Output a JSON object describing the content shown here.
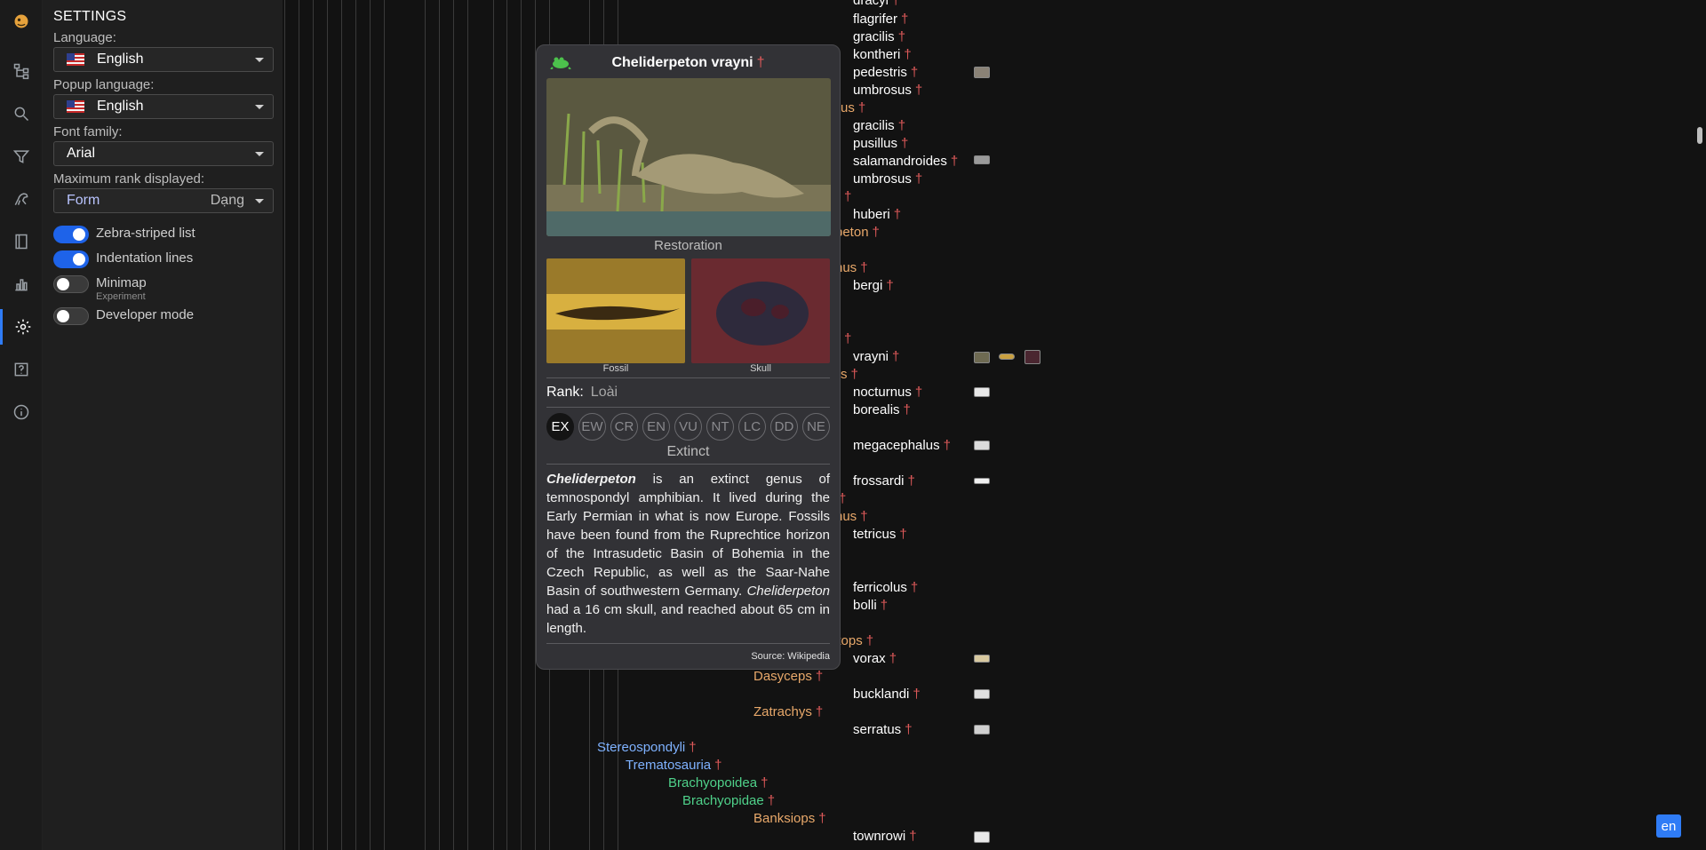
{
  "nav": {
    "items": [
      {
        "name": "logo-icon"
      },
      {
        "name": "tree-icon"
      },
      {
        "name": "search-icon"
      },
      {
        "name": "filter-icon"
      },
      {
        "name": "dinosaur-icon"
      },
      {
        "name": "book-icon"
      },
      {
        "name": "stats-icon"
      },
      {
        "name": "settings-icon"
      },
      {
        "name": "help-icon"
      },
      {
        "name": "info-icon"
      }
    ]
  },
  "settings": {
    "title": "SETTINGS",
    "language_label": "Language:",
    "language_value": "English",
    "popup_language_label": "Popup language:",
    "popup_language_value": "English",
    "font_label": "Font family:",
    "font_value": "Arial",
    "rank_label": "Maximum rank displayed:",
    "rank_value": "Form",
    "rank_value_local": "Dạng",
    "toggles": [
      {
        "label": "Zebra-striped list",
        "on": true
      },
      {
        "label": "Indentation lines",
        "on": true
      },
      {
        "label": "Minimap",
        "sub": "Experiment",
        "on": false
      },
      {
        "label": "Developer mode",
        "on": false
      }
    ]
  },
  "tree": {
    "dagger": "†",
    "species": [
      {
        "name": "dracyi"
      },
      {
        "name": "flagrifer"
      },
      {
        "name": "gracilis"
      },
      {
        "name": "kontheri"
      },
      {
        "name": "pedestris"
      },
      {
        "name": "umbrosus"
      },
      {
        "name": "gracilis"
      },
      {
        "name": "pusillus"
      },
      {
        "name": "salamandroides"
      },
      {
        "name": "umbrosus"
      },
      {
        "name": "huberi"
      },
      {
        "name": "bergi"
      },
      {
        "name": "vrayni"
      },
      {
        "name": "nocturnus"
      },
      {
        "name": "borealis"
      },
      {
        "name": "megacephalus"
      },
      {
        "name": "frossardi"
      },
      {
        "name": "tetricus"
      },
      {
        "name": "ferricolus"
      },
      {
        "name": "bolli"
      },
      {
        "name": "vorax"
      },
      {
        "name": "bucklandi"
      },
      {
        "name": "serratus"
      },
      {
        "name": "townrowi"
      }
    ],
    "genus_fragments": [
      "us",
      "peton",
      "nus",
      "s",
      "nus",
      "atops"
    ],
    "genera": [
      "Dasyceps",
      "Zatrachys",
      "Banksiops"
    ],
    "families": [
      {
        "name": "Stereospondyli",
        "color": "#7fb2ff"
      },
      {
        "name": "Trematosauria",
        "color": "#7fb2ff"
      },
      {
        "name": "Brachyopoidea",
        "color": "#4fd18a"
      },
      {
        "name": "Brachyopidae",
        "color": "#4fd18a"
      }
    ]
  },
  "popup": {
    "title": "Cheliderpeton vrayni",
    "dagger": "†",
    "main_caption": "Restoration",
    "fossil_caption": "Fossil",
    "skull_caption": "Skull",
    "rank_label": "Rank:",
    "rank_value": "Loài",
    "iucn": [
      "EX",
      "EW",
      "CR",
      "EN",
      "VU",
      "NT",
      "LC",
      "DD",
      "NE"
    ],
    "status": "Extinct",
    "desc_1": "Cheliderpeton",
    "desc_2": " is an extinct genus of temnospondyl amphibian. It lived during the Early Permian in what is now Europe. Fossils have been found from the Ruprechtice horizon of the Intrasudetic Basin of Bohemia in the Czech Republic, as well as the Saar-Nahe Basin of southwestern Germany. ",
    "desc_3": "Cheliderpeton",
    "desc_4": " had a 16 cm skull, and reached about 65 cm in length.",
    "source": "Source: Wikipedia"
  },
  "lang_badge": "en",
  "colors": {
    "accent": "#2f7cf6",
    "dagger": "#e05a5a",
    "genus": "#e8a86a",
    "clade_blue": "#7fb2ff",
    "clade_green": "#4fd18a"
  }
}
